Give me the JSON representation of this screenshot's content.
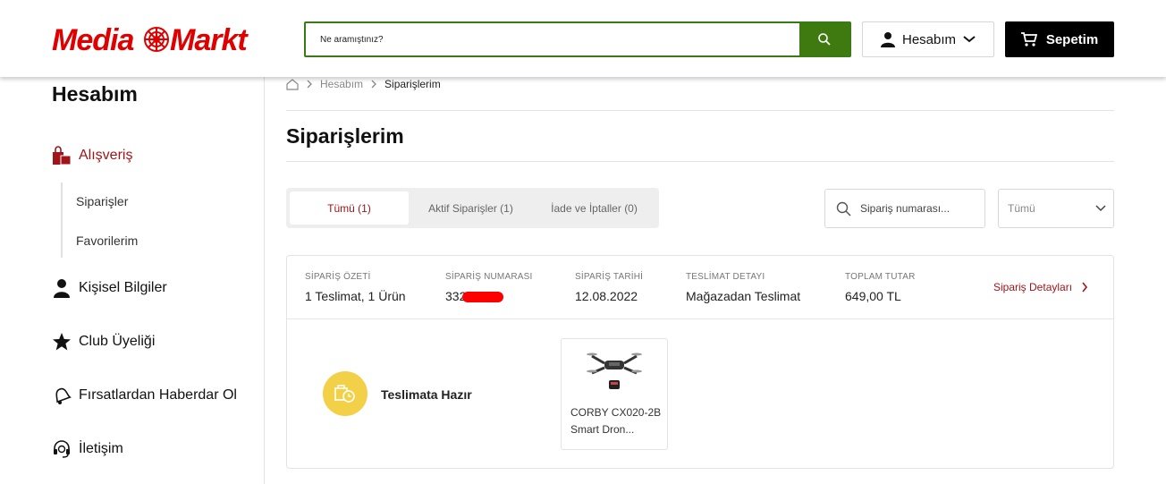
{
  "header": {
    "logo_text": "MediaMarkt",
    "search_placeholder": "Ne aramıştınız?",
    "account_label": "Hesabım",
    "cart_label": "Sepetim"
  },
  "sidebar": {
    "title": "Hesabım",
    "items": [
      {
        "label": "Alışveriş",
        "icon": "shopping-bags-icon"
      },
      {
        "label": "Kişisel Bilgiler",
        "icon": "person-icon"
      },
      {
        "label": "Club Üyeliği",
        "icon": "star-icon"
      },
      {
        "label": "Fırsatlardan Haberdar Ol",
        "icon": "bell-icon"
      },
      {
        "label": "İletişim",
        "icon": "headset-icon"
      }
    ],
    "subitems": [
      "Siparişler",
      "Favorilerim"
    ]
  },
  "breadcrumb": {
    "level1": "Hesabım",
    "level2": "Siparişlerim"
  },
  "page_title": "Siparişlerim",
  "tabs": [
    "Tümü (1)",
    "Aktif Siparişler (1)",
    "İade ve İptaller (0)"
  ],
  "order_search": {
    "placeholder": "Sipariş numarası..."
  },
  "filter": {
    "value": "Tümü"
  },
  "order": {
    "summary_label": "SİPARİŞ ÖZETİ",
    "summary_value": "1 Teslimat, 1 Ürün",
    "number_label": "SİPARİŞ NUMARASI",
    "number_value": "332",
    "date_label": "SİPARİŞ TARİHİ",
    "date_value": "12.08.2022",
    "delivery_label": "TESLİMAT DETAYI",
    "delivery_value": "Mağazadan Teslimat",
    "total_label": "TOPLAM TUTAR",
    "total_value": "649,00 TL",
    "details_link": "Sipariş Detayları",
    "status": "Teslimata Hazır",
    "product_name": "CORBY CX020-2B Smart Dron..."
  },
  "colors": {
    "brand_red": "#df0000",
    "accent_green": "#3f7a10",
    "active_red": "#a0151a",
    "status_yellow": "#f2d047"
  }
}
